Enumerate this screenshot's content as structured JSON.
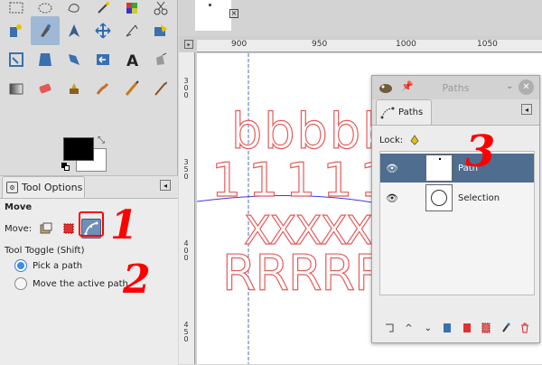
{
  "colors": {
    "accent": "#4e6d8f",
    "annotation": "#ff0000",
    "glyph_outline": "#e85a5a",
    "guide_line": "#4a72c4",
    "path_curve": "#3b3bd8"
  },
  "toolbox": {
    "tools": [
      [
        "rect-select-icon",
        "ellipse-select-icon",
        "free-select-icon",
        "fuzzy-select-icon",
        "color-select-icon",
        "scissors-icon"
      ],
      [
        "foreground-select-icon",
        "paths-tool-icon",
        "color-picker-icon",
        "zoom-icon",
        "measure-icon",
        "move-icon"
      ],
      [
        "align-icon",
        "crop-icon",
        "rotate-icon",
        "scale-icon",
        "shear-icon",
        "perspective-icon"
      ],
      [
        "flip-icon",
        "cage-icon",
        "text-icon",
        "bucket-fill-icon",
        "blend-icon",
        "pencil-icon"
      ],
      [
        "paintbrush-icon",
        "eraser-icon",
        "airbrush-icon",
        "ink-icon",
        "clone-icon",
        "heal-icon"
      ]
    ],
    "active_tool": "paths-tool-icon"
  },
  "tool_options": {
    "tab_label": "Tool Options",
    "title": "Move",
    "move_label": "Move:",
    "move_options": [
      "layer-mode-icon",
      "selection-mode-icon",
      "path-mode-icon"
    ],
    "active_move_option": "path-mode-icon",
    "toggle_label": "Tool Toggle  (Shift)",
    "options": [
      {
        "label": "Pick a path",
        "selected": true
      },
      {
        "label": "Move the active path",
        "selected": false
      }
    ]
  },
  "canvas": {
    "hruler_labels": [
      "900",
      "950",
      "1000",
      "1050"
    ],
    "vruler_labels": [
      "300",
      "350",
      "400",
      "450"
    ],
    "text_lines": [
      "bbbbb",
      "11111",
      "XXXXX",
      "RRRRR"
    ]
  },
  "paths_dock": {
    "window_title": "Paths",
    "tab_label": "Paths",
    "lock_label": "Lock:",
    "items": [
      {
        "name": "Path",
        "visible": true,
        "selected": true
      },
      {
        "name": "Selection",
        "visible": true,
        "selected": false
      }
    ],
    "bottom_buttons": [
      "new-path-icon",
      "raise-path-icon",
      "lower-path-icon",
      "duplicate-path-icon",
      "path-to-selection-icon",
      "selection-to-path-icon",
      "paint-along-path-icon",
      "delete-path-icon"
    ]
  },
  "annotations": [
    "1",
    "2",
    "3"
  ]
}
